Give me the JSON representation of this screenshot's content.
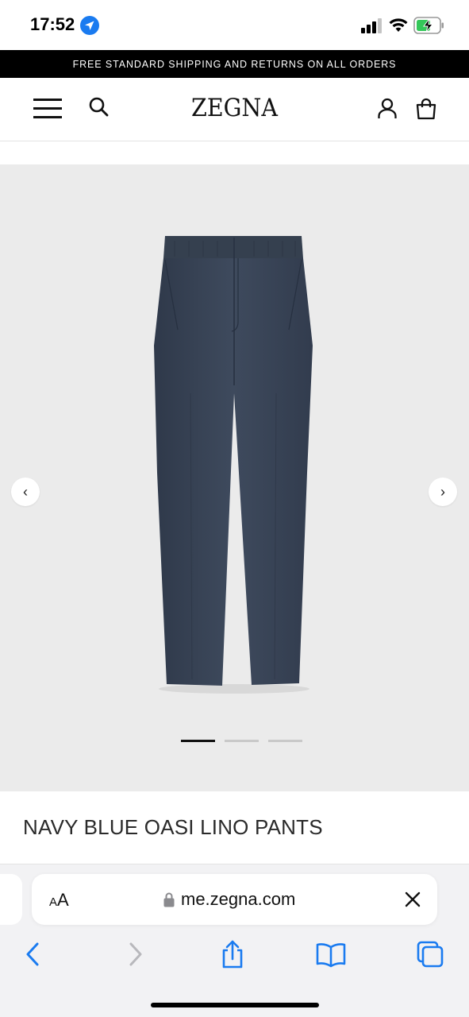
{
  "status_bar": {
    "time": "17:52",
    "icons": [
      "location-arrow-icon",
      "cellular-signal-icon",
      "wifi-icon",
      "battery-charging-icon"
    ]
  },
  "promo": {
    "text": "FREE STANDARD SHIPPING AND RETURNS ON ALL ORDERS"
  },
  "header": {
    "logo": "ZEGNA",
    "icons": [
      "menu-icon",
      "search-icon",
      "account-icon",
      "shopping-bag-icon"
    ]
  },
  "gallery": {
    "image_count": 3,
    "active_index": 0,
    "icons": [
      "chevron-left-icon",
      "chevron-right-icon"
    ],
    "prev_glyph": "‹",
    "next_glyph": "›"
  },
  "product": {
    "title": "NAVY BLUE OASI LINO PANTS",
    "color": "#3a4557"
  },
  "browser": {
    "aa_small": "A",
    "aa_large": "A",
    "url": "me.zegna.com",
    "icons": [
      "lock-icon",
      "close-icon",
      "back-icon",
      "forward-icon",
      "share-icon",
      "bookmarks-icon",
      "tabs-icon"
    ],
    "accent": "#1a7bf0"
  }
}
